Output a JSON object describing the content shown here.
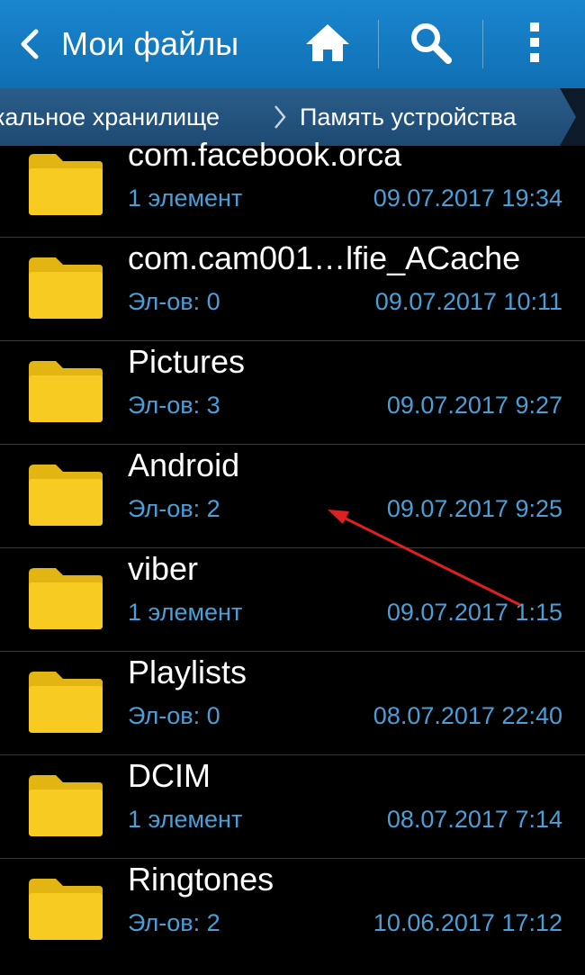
{
  "app": {
    "title": "Мои файлы"
  },
  "action_bar": {
    "back_icon": "chevron-left-icon",
    "home_icon": "home-icon",
    "search_icon": "search-icon",
    "more_icon": "more-vertical-icon",
    "color": "#1a86cf"
  },
  "breadcrumb": {
    "items": [
      {
        "label": "кальное хранилище"
      },
      {
        "label": "Память устройства"
      }
    ]
  },
  "files": [
    {
      "name": "com.facebook.orca",
      "count": "1 элемент",
      "date": "09.07.2017 19:34"
    },
    {
      "name": "com.cam001…lfie_ACache",
      "count": "Эл-ов: 0",
      "date": "09.07.2017 10:11"
    },
    {
      "name": "Pictures",
      "count": "Эл-ов: 3",
      "date": "09.07.2017 9:27"
    },
    {
      "name": "Android",
      "count": "Эл-ов: 2",
      "date": "09.07.2017 9:25"
    },
    {
      "name": "viber",
      "count": "1 элемент",
      "date": "09.07.2017 1:15"
    },
    {
      "name": "Playlists",
      "count": "Эл-ов: 0",
      "date": "08.07.2017 22:40"
    },
    {
      "name": "DCIM",
      "count": "1 элемент",
      "date": "08.07.2017 7:14"
    },
    {
      "name": "Ringtones",
      "count": "Эл-ов: 2",
      "date": "10.06.2017 17:12"
    }
  ],
  "colors": {
    "folder": "#f5c81f",
    "meta_text": "#4a9fd8",
    "annotation_arrow": "#e02020"
  }
}
